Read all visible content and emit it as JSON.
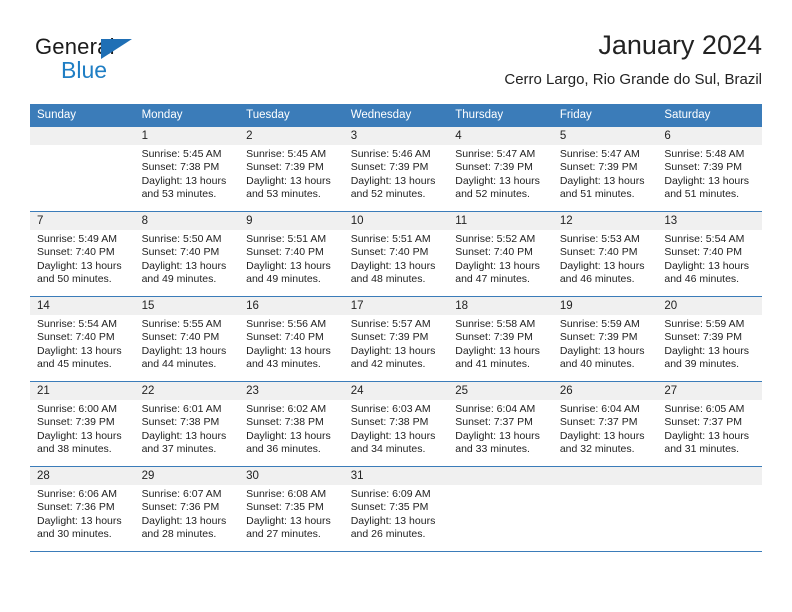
{
  "logo": {
    "word_top": "General",
    "word_bottom": "Blue",
    "triangle_color": "#1f6fb5",
    "blue_color": "#1f7ec4"
  },
  "header": {
    "title": "January 2024",
    "subtitle": "Cerro Largo, Rio Grande do Sul, Brazil"
  },
  "colors": {
    "header_band": "#3b7cb9",
    "daynum_band": "#f0f0f0",
    "text": "#222222"
  },
  "weekday_headers": [
    "Sunday",
    "Monday",
    "Tuesday",
    "Wednesday",
    "Thursday",
    "Friday",
    "Saturday"
  ],
  "weeks": [
    [
      {
        "day": "",
        "sunrise": "",
        "sunset": "",
        "daylight_line1": "",
        "daylight_line2": ""
      },
      {
        "day": "1",
        "sunrise": "Sunrise: 5:45 AM",
        "sunset": "Sunset: 7:38 PM",
        "daylight_line1": "Daylight: 13 hours",
        "daylight_line2": "and 53 minutes."
      },
      {
        "day": "2",
        "sunrise": "Sunrise: 5:45 AM",
        "sunset": "Sunset: 7:39 PM",
        "daylight_line1": "Daylight: 13 hours",
        "daylight_line2": "and 53 minutes."
      },
      {
        "day": "3",
        "sunrise": "Sunrise: 5:46 AM",
        "sunset": "Sunset: 7:39 PM",
        "daylight_line1": "Daylight: 13 hours",
        "daylight_line2": "and 52 minutes."
      },
      {
        "day": "4",
        "sunrise": "Sunrise: 5:47 AM",
        "sunset": "Sunset: 7:39 PM",
        "daylight_line1": "Daylight: 13 hours",
        "daylight_line2": "and 52 minutes."
      },
      {
        "day": "5",
        "sunrise": "Sunrise: 5:47 AM",
        "sunset": "Sunset: 7:39 PM",
        "daylight_line1": "Daylight: 13 hours",
        "daylight_line2": "and 51 minutes."
      },
      {
        "day": "6",
        "sunrise": "Sunrise: 5:48 AM",
        "sunset": "Sunset: 7:39 PM",
        "daylight_line1": "Daylight: 13 hours",
        "daylight_line2": "and 51 minutes."
      }
    ],
    [
      {
        "day": "7",
        "sunrise": "Sunrise: 5:49 AM",
        "sunset": "Sunset: 7:40 PM",
        "daylight_line1": "Daylight: 13 hours",
        "daylight_line2": "and 50 minutes."
      },
      {
        "day": "8",
        "sunrise": "Sunrise: 5:50 AM",
        "sunset": "Sunset: 7:40 PM",
        "daylight_line1": "Daylight: 13 hours",
        "daylight_line2": "and 49 minutes."
      },
      {
        "day": "9",
        "sunrise": "Sunrise: 5:51 AM",
        "sunset": "Sunset: 7:40 PM",
        "daylight_line1": "Daylight: 13 hours",
        "daylight_line2": "and 49 minutes."
      },
      {
        "day": "10",
        "sunrise": "Sunrise: 5:51 AM",
        "sunset": "Sunset: 7:40 PM",
        "daylight_line1": "Daylight: 13 hours",
        "daylight_line2": "and 48 minutes."
      },
      {
        "day": "11",
        "sunrise": "Sunrise: 5:52 AM",
        "sunset": "Sunset: 7:40 PM",
        "daylight_line1": "Daylight: 13 hours",
        "daylight_line2": "and 47 minutes."
      },
      {
        "day": "12",
        "sunrise": "Sunrise: 5:53 AM",
        "sunset": "Sunset: 7:40 PM",
        "daylight_line1": "Daylight: 13 hours",
        "daylight_line2": "and 46 minutes."
      },
      {
        "day": "13",
        "sunrise": "Sunrise: 5:54 AM",
        "sunset": "Sunset: 7:40 PM",
        "daylight_line1": "Daylight: 13 hours",
        "daylight_line2": "and 46 minutes."
      }
    ],
    [
      {
        "day": "14",
        "sunrise": "Sunrise: 5:54 AM",
        "sunset": "Sunset: 7:40 PM",
        "daylight_line1": "Daylight: 13 hours",
        "daylight_line2": "and 45 minutes."
      },
      {
        "day": "15",
        "sunrise": "Sunrise: 5:55 AM",
        "sunset": "Sunset: 7:40 PM",
        "daylight_line1": "Daylight: 13 hours",
        "daylight_line2": "and 44 minutes."
      },
      {
        "day": "16",
        "sunrise": "Sunrise: 5:56 AM",
        "sunset": "Sunset: 7:40 PM",
        "daylight_line1": "Daylight: 13 hours",
        "daylight_line2": "and 43 minutes."
      },
      {
        "day": "17",
        "sunrise": "Sunrise: 5:57 AM",
        "sunset": "Sunset: 7:39 PM",
        "daylight_line1": "Daylight: 13 hours",
        "daylight_line2": "and 42 minutes."
      },
      {
        "day": "18",
        "sunrise": "Sunrise: 5:58 AM",
        "sunset": "Sunset: 7:39 PM",
        "daylight_line1": "Daylight: 13 hours",
        "daylight_line2": "and 41 minutes."
      },
      {
        "day": "19",
        "sunrise": "Sunrise: 5:59 AM",
        "sunset": "Sunset: 7:39 PM",
        "daylight_line1": "Daylight: 13 hours",
        "daylight_line2": "and 40 minutes."
      },
      {
        "day": "20",
        "sunrise": "Sunrise: 5:59 AM",
        "sunset": "Sunset: 7:39 PM",
        "daylight_line1": "Daylight: 13 hours",
        "daylight_line2": "and 39 minutes."
      }
    ],
    [
      {
        "day": "21",
        "sunrise": "Sunrise: 6:00 AM",
        "sunset": "Sunset: 7:39 PM",
        "daylight_line1": "Daylight: 13 hours",
        "daylight_line2": "and 38 minutes."
      },
      {
        "day": "22",
        "sunrise": "Sunrise: 6:01 AM",
        "sunset": "Sunset: 7:38 PM",
        "daylight_line1": "Daylight: 13 hours",
        "daylight_line2": "and 37 minutes."
      },
      {
        "day": "23",
        "sunrise": "Sunrise: 6:02 AM",
        "sunset": "Sunset: 7:38 PM",
        "daylight_line1": "Daylight: 13 hours",
        "daylight_line2": "and 36 minutes."
      },
      {
        "day": "24",
        "sunrise": "Sunrise: 6:03 AM",
        "sunset": "Sunset: 7:38 PM",
        "daylight_line1": "Daylight: 13 hours",
        "daylight_line2": "and 34 minutes."
      },
      {
        "day": "25",
        "sunrise": "Sunrise: 6:04 AM",
        "sunset": "Sunset: 7:37 PM",
        "daylight_line1": "Daylight: 13 hours",
        "daylight_line2": "and 33 minutes."
      },
      {
        "day": "26",
        "sunrise": "Sunrise: 6:04 AM",
        "sunset": "Sunset: 7:37 PM",
        "daylight_line1": "Daylight: 13 hours",
        "daylight_line2": "and 32 minutes."
      },
      {
        "day": "27",
        "sunrise": "Sunrise: 6:05 AM",
        "sunset": "Sunset: 7:37 PM",
        "daylight_line1": "Daylight: 13 hours",
        "daylight_line2": "and 31 minutes."
      }
    ],
    [
      {
        "day": "28",
        "sunrise": "Sunrise: 6:06 AM",
        "sunset": "Sunset: 7:36 PM",
        "daylight_line1": "Daylight: 13 hours",
        "daylight_line2": "and 30 minutes."
      },
      {
        "day": "29",
        "sunrise": "Sunrise: 6:07 AM",
        "sunset": "Sunset: 7:36 PM",
        "daylight_line1": "Daylight: 13 hours",
        "daylight_line2": "and 28 minutes."
      },
      {
        "day": "30",
        "sunrise": "Sunrise: 6:08 AM",
        "sunset": "Sunset: 7:35 PM",
        "daylight_line1": "Daylight: 13 hours",
        "daylight_line2": "and 27 minutes."
      },
      {
        "day": "31",
        "sunrise": "Sunrise: 6:09 AM",
        "sunset": "Sunset: 7:35 PM",
        "daylight_line1": "Daylight: 13 hours",
        "daylight_line2": "and 26 minutes."
      },
      {
        "day": "",
        "sunrise": "",
        "sunset": "",
        "daylight_line1": "",
        "daylight_line2": ""
      },
      {
        "day": "",
        "sunrise": "",
        "sunset": "",
        "daylight_line1": "",
        "daylight_line2": ""
      },
      {
        "day": "",
        "sunrise": "",
        "sunset": "",
        "daylight_line1": "",
        "daylight_line2": ""
      }
    ]
  ]
}
